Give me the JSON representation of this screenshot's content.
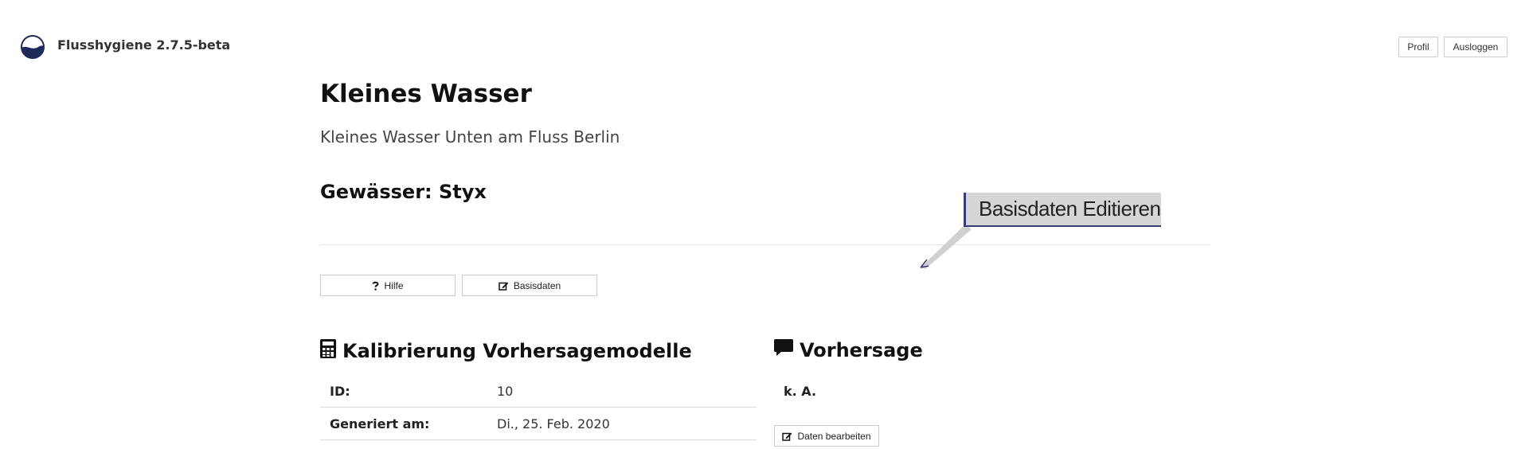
{
  "app": {
    "title": "Flusshygiene 2.7.5-beta"
  },
  "header": {
    "profile_label": "Profil",
    "logout_label": "Ausloggen"
  },
  "page": {
    "title": "Kleines Wasser",
    "subtitle": "Kleines Wasser Unten am Fluss Berlin",
    "water_heading": "Gewässer: Styx"
  },
  "actions": {
    "help_label": "Hilfe",
    "basisdaten_label": "Basisdaten"
  },
  "tooltip": {
    "text": "Basisdaten Editieren"
  },
  "calibration": {
    "heading": "Kalibrierung Vorhersagemodelle",
    "icon": "calculator-icon",
    "rows": [
      {
        "label": "ID:",
        "value": "10"
      },
      {
        "label": "Generiert am:",
        "value": "Di., 25. Feb. 2020"
      }
    ]
  },
  "forecast": {
    "heading": "Vorhersage",
    "icon": "comment-icon",
    "value": "k. A.",
    "edit_label": "Daten bearbeiten"
  },
  "colors": {
    "brand": "#1e2a5a",
    "tooltip_bg": "#d6d6d6",
    "tooltip_border": "#3a3a7a"
  }
}
